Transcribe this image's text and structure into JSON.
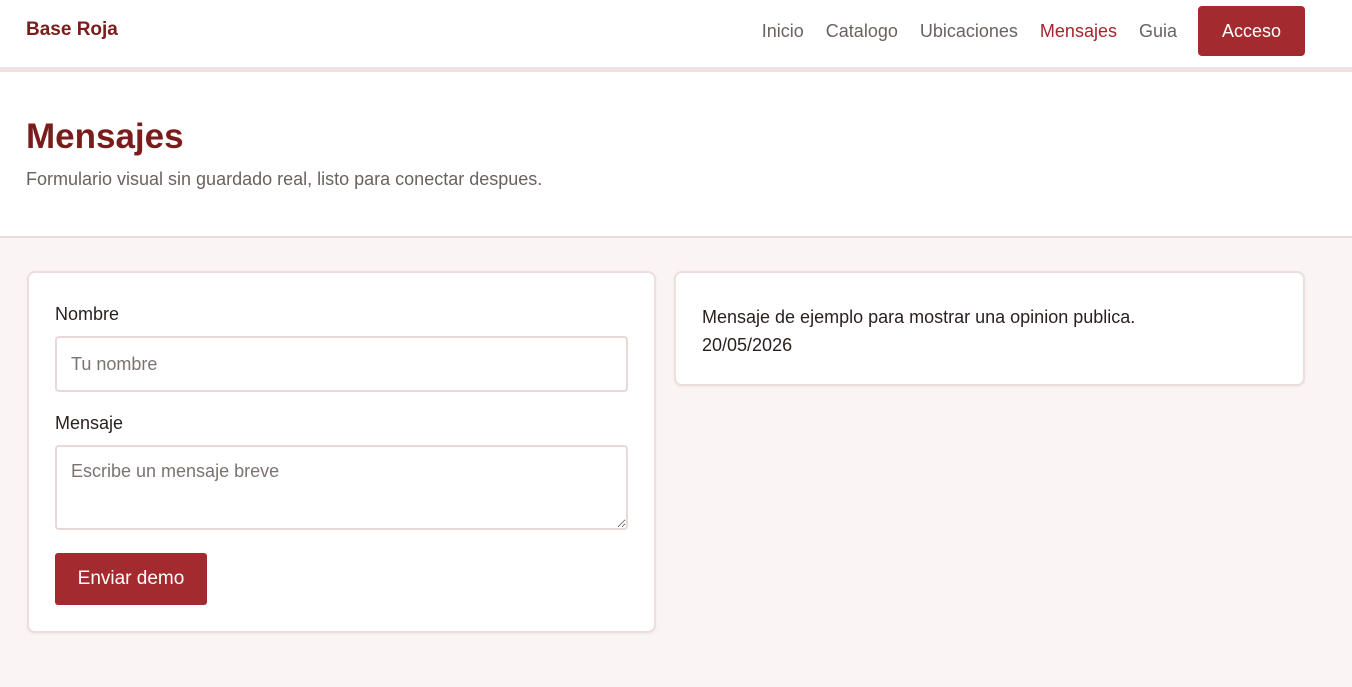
{
  "header": {
    "brand": "Base Roja",
    "nav": [
      {
        "label": "Inicio"
      },
      {
        "label": "Catalogo"
      },
      {
        "label": "Ubicaciones"
      },
      {
        "label": "Mensajes",
        "active": true
      },
      {
        "label": "Guia"
      }
    ],
    "login_label": "Acceso"
  },
  "hero": {
    "title": "Mensajes",
    "subtitle": "Formulario visual sin guardado real, listo para conectar despues."
  },
  "form": {
    "name_label": "Nombre",
    "name_value": "",
    "name_placeholder": "Tu nombre",
    "message_label": "Mensaje",
    "message_value": "",
    "message_placeholder": "Escribe un mensaje breve",
    "submit_label": "Enviar demo"
  },
  "messages": [
    {
      "text": "Mensaje de ejemplo para mostrar una opinion publica.",
      "date": "20/05/2026"
    }
  ],
  "colors": {
    "brand": "#7a1c1c",
    "accent": "#a32a2e",
    "background": "#faf5f4"
  }
}
